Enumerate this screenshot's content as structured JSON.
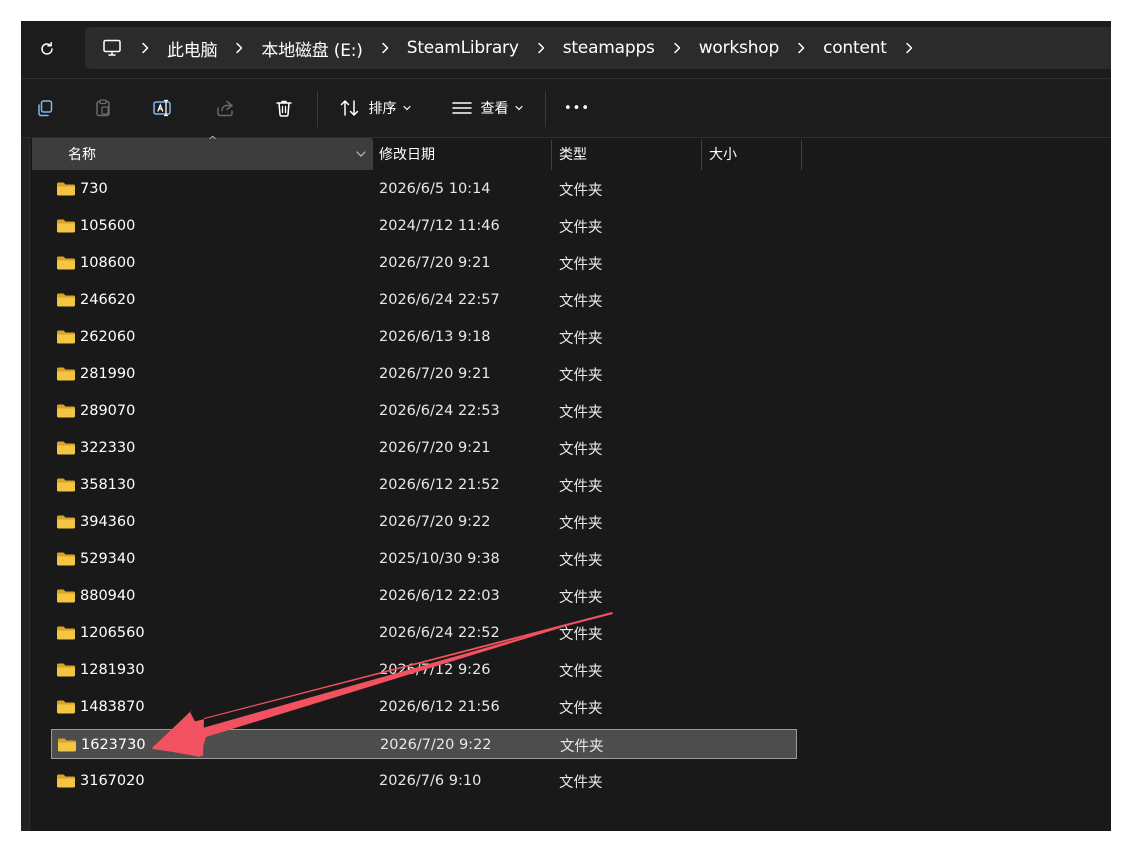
{
  "breadcrumb": {
    "home_icon": "computer-icon",
    "items": [
      "此电脑",
      "本地磁盘 (E:)",
      "SteamLibrary",
      "steamapps",
      "workshop",
      "content"
    ]
  },
  "toolbar": {
    "sort_label": "排序",
    "view_label": "查看",
    "more_label": "•••"
  },
  "columns": {
    "name": "名称",
    "date": "修改日期",
    "type": "类型",
    "size": "大小"
  },
  "rows": [
    {
      "name": "730",
      "date": "2026/6/5 10:14",
      "type": "文件夹"
    },
    {
      "name": "105600",
      "date": "2024/7/12 11:46",
      "type": "文件夹"
    },
    {
      "name": "108600",
      "date": "2026/7/20 9:21",
      "type": "文件夹"
    },
    {
      "name": "246620",
      "date": "2026/6/24 22:57",
      "type": "文件夹"
    },
    {
      "name": "262060",
      "date": "2026/6/13 9:18",
      "type": "文件夹"
    },
    {
      "name": "281990",
      "date": "2026/7/20 9:21",
      "type": "文件夹"
    },
    {
      "name": "289070",
      "date": "2026/6/24 22:53",
      "type": "文件夹"
    },
    {
      "name": "322330",
      "date": "2026/7/20 9:21",
      "type": "文件夹"
    },
    {
      "name": "358130",
      "date": "2026/6/12 21:52",
      "type": "文件夹"
    },
    {
      "name": "394360",
      "date": "2026/7/20 9:22",
      "type": "文件夹"
    },
    {
      "name": "529340",
      "date": "2025/10/30 9:38",
      "type": "文件夹"
    },
    {
      "name": "880940",
      "date": "2026/6/12 22:03",
      "type": "文件夹"
    },
    {
      "name": "1206560",
      "date": "2026/6/24 22:52",
      "type": "文件夹"
    },
    {
      "name": "1281930",
      "date": "2026/7/12 9:26",
      "type": "文件夹"
    },
    {
      "name": "1483870",
      "date": "2026/6/12 21:56",
      "type": "文件夹"
    },
    {
      "name": "1623730",
      "date": "2026/7/20 9:22",
      "type": "文件夹",
      "selected": true
    },
    {
      "name": "3167020",
      "date": "2026/7/6 9:10",
      "type": "文件夹"
    }
  ],
  "colors": {
    "folder": "#f4c542",
    "arrow": "#f2525f",
    "selection": "#4d4d4d"
  }
}
